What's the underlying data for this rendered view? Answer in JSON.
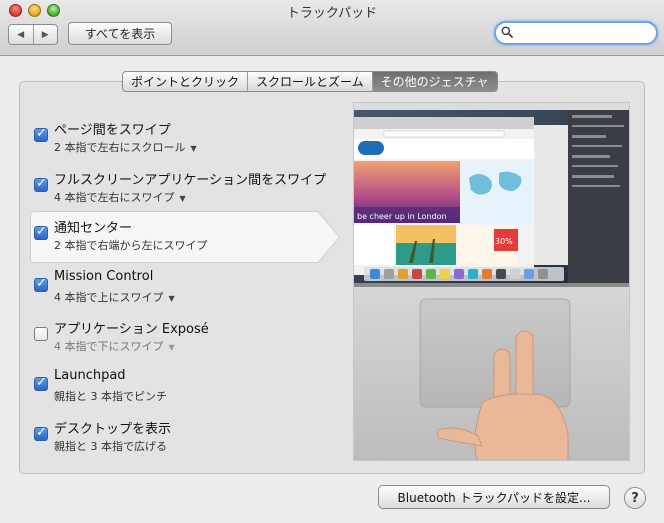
{
  "window": {
    "title": "トラックパッド"
  },
  "toolbar": {
    "back_icon": "back-arrow-icon",
    "forward_icon": "forward-arrow-icon",
    "show_all_label": "すべてを表示",
    "search_value": ""
  },
  "tabs": [
    {
      "label": "ポイントとクリック",
      "active": false
    },
    {
      "label": "スクロールとズーム",
      "active": false
    },
    {
      "label": "その他のジェスチャ",
      "active": true
    }
  ],
  "gestures": [
    {
      "title": "ページ間をスワイプ",
      "subtitle": "2 本指で左右にスクロール",
      "checked": true,
      "enabled": true
    },
    {
      "title": "フルスクリーンアプリケーション間をスワイプ",
      "subtitle": "4 本指で左右にスワイプ",
      "checked": true,
      "enabled": true
    },
    {
      "title": "通知センター",
      "subtitle": "2 本指で右端から左にスワイプ",
      "checked": true,
      "enabled": true,
      "selected": true
    },
    {
      "title": "Mission Control",
      "subtitle": "4 本指で上にスワイプ",
      "checked": true,
      "enabled": true
    },
    {
      "title": "アプリケーション Exposé",
      "subtitle": "4 本指で下にスワイプ",
      "checked": false,
      "enabled": false
    },
    {
      "title": "Launchpad",
      "subtitle": "親指と 3 本指でピンチ",
      "checked": true,
      "enabled": true
    },
    {
      "title": "デスクトップを表示",
      "subtitle": "親指と 3 本指で広げる",
      "checked": true,
      "enabled": true
    }
  ],
  "preview": {
    "browser_headline": "be cheer up in London",
    "ad_text": "30%"
  },
  "footer": {
    "bluetooth_label": "Bluetooth トラックパッドを設定...",
    "help_label": "?"
  },
  "colors": {
    "accent": "#2a66c2",
    "tab_active": "#7a7a7a"
  }
}
